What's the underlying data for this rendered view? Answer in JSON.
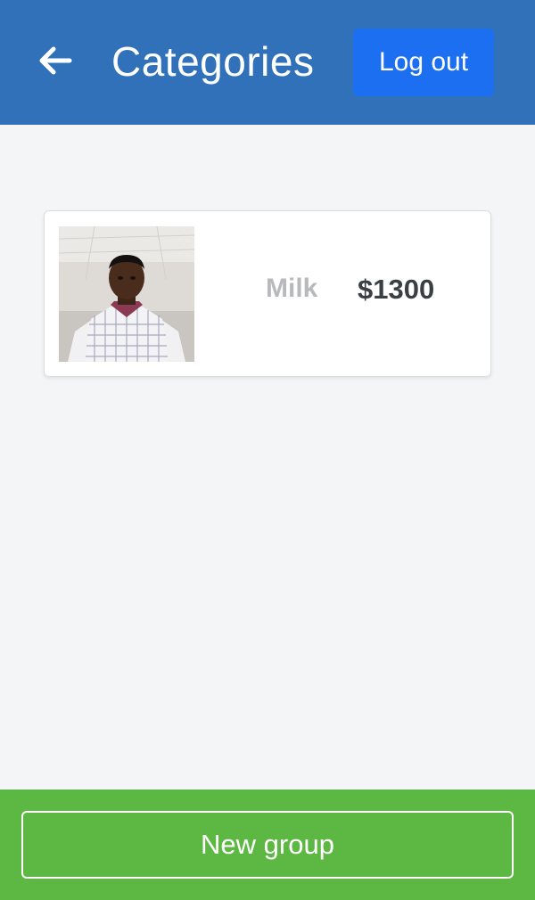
{
  "header": {
    "back_icon": "arrow-left-icon",
    "title": "Categories",
    "logout_label": "Log out"
  },
  "items": [
    {
      "name": "Milk",
      "price": "$1300",
      "image": "person-selfie-photo"
    }
  ],
  "footer": {
    "new_group_label": "New group"
  },
  "colors": {
    "header_bg": "#3071b9",
    "logout_bg": "#1d6ff2",
    "page_bg": "#f4f5f7",
    "footer_bg": "#5db843"
  }
}
